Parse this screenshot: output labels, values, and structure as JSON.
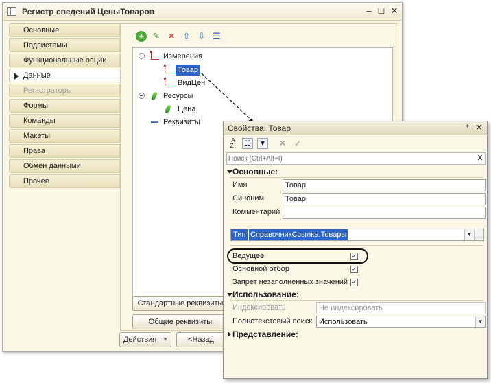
{
  "main_window": {
    "title": "Регистр сведений ЦеныТоваров",
    "nav_items": [
      {
        "label": "Основные",
        "state": "normal"
      },
      {
        "label": "Подсистемы",
        "state": "normal"
      },
      {
        "label": "Функциональные опции",
        "state": "normal"
      },
      {
        "label": "Данные",
        "state": "active"
      },
      {
        "label": "Регистраторы",
        "state": "disabled"
      },
      {
        "label": "Формы",
        "state": "normal"
      },
      {
        "label": "Команды",
        "state": "normal"
      },
      {
        "label": "Макеты",
        "state": "normal"
      },
      {
        "label": "Права",
        "state": "normal"
      },
      {
        "label": "Обмен данными",
        "state": "normal"
      },
      {
        "label": "Прочее",
        "state": "normal"
      }
    ],
    "toolbar_icons": [
      "add-icon",
      "edit-icon",
      "delete-icon",
      "move-up-icon",
      "move-down-icon",
      "sort-icon"
    ],
    "tree": {
      "dimensions": "Измерения",
      "dim_items": [
        "Товар",
        "ВидЦен"
      ],
      "resources": "Ресурсы",
      "res_items": [
        "Цена"
      ],
      "attributes": "Реквизиты"
    },
    "buttons": {
      "standard_attrs": "Стандартные реквизиты",
      "common_attrs": "Общие реквизиты",
      "actions": "Действия",
      "back": "<Назад"
    }
  },
  "props_window": {
    "title": "Свойства: Товар",
    "search_placeholder": "Поиск (Ctrl+Alt+I)",
    "sections": {
      "basic": "Основные:",
      "usage": "Использование:",
      "presentation": "Представление:"
    },
    "fields": {
      "name_label": "Имя",
      "name_value": "Товар",
      "synonym_label": "Синоним",
      "synonym_value": "Товар",
      "comment_label": "Комментарий",
      "comment_value": "",
      "type_label": "Тип",
      "type_value": "СправочникСсылка.Товары",
      "leading_label": "Ведущее",
      "main_filter_label": "Основной отбор",
      "deny_empty_label": "Запрет незаполненных значений",
      "index_label": "Индексировать",
      "index_value": "Не индексировать",
      "fulltext_label": "Полнотекстовый поиск",
      "fulltext_value": "Использовать"
    },
    "checkboxes": {
      "leading": true,
      "main_filter": true,
      "deny_empty": true
    }
  },
  "colors": {
    "selection": "#2e64c6",
    "window_bg": "#fbf7e6",
    "annotation": "#111111"
  }
}
